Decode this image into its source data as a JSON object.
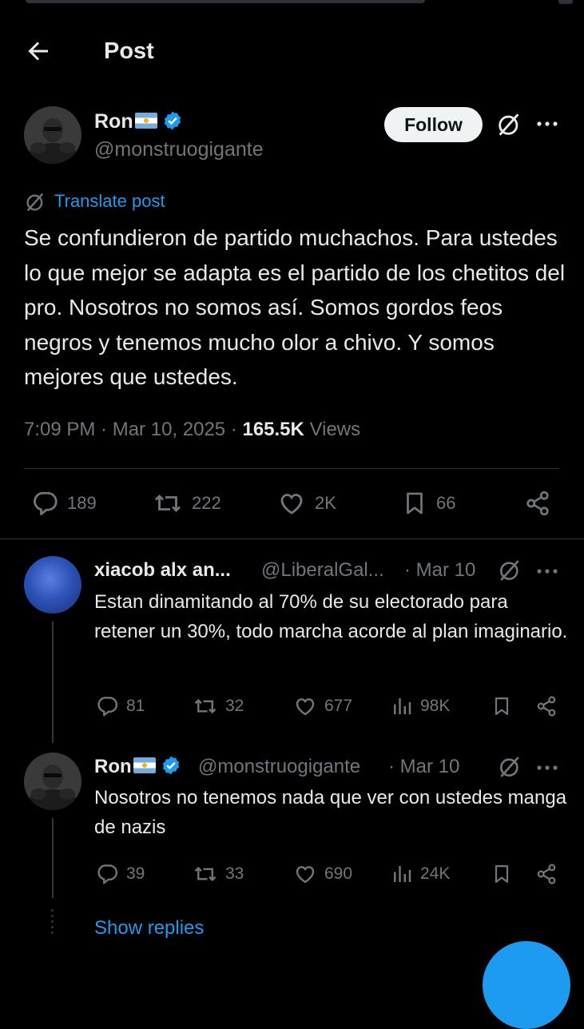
{
  "header": {
    "title": "Post"
  },
  "main_post": {
    "author_name": "Ron",
    "author_handle": "@monstruogigante",
    "follow_label": "Follow",
    "translate_label": "Translate post",
    "text": "Se confundieron de partido muchachos. Para ustedes lo que mejor se adapta es el partido de los chetitos del pro. Nosotros no somos así. Somos gordos feos negros y tenemos mucho olor a chivo. Y somos mejores que ustedes.",
    "time": "7:09 PM",
    "date": "Mar 10, 2025",
    "views_count": "165.5K",
    "views_label": "Views",
    "stats": {
      "replies": "189",
      "reposts": "222",
      "likes": "2K",
      "bookmarks": "66"
    }
  },
  "replies": [
    {
      "author_name": "xiacob alx an...",
      "author_handle": "@LiberalGal...",
      "date": "Mar 10",
      "text": "Estan dinamitando al 70% de su electorado para retener un 30%, todo marcha acorde al plan imaginario.",
      "stats": {
        "replies": "81",
        "reposts": "32",
        "likes": "677",
        "views": "98K"
      }
    },
    {
      "author_name": "Ron",
      "author_handle": "@monstruogigante",
      "date": "Mar 10",
      "text": "Nosotros no tenemos nada que ver con ustedes manga de nazis",
      "stats": {
        "replies": "39",
        "reposts": "33",
        "likes": "690",
        "views": "24K"
      }
    }
  ],
  "show_replies_label": "Show replies",
  "colors": {
    "background": "#000000",
    "text": "#e7e9ea",
    "muted": "#71767b",
    "accent": "#1d9bf0",
    "divider": "#2f3336"
  },
  "icons": [
    "back-arrow-icon",
    "verified-badge-icon",
    "argentina-flag-icon",
    "grok-icon",
    "more-icon",
    "translate-icon",
    "reply-icon",
    "repost-icon",
    "like-icon",
    "bookmark-icon",
    "share-icon",
    "views-icon"
  ]
}
